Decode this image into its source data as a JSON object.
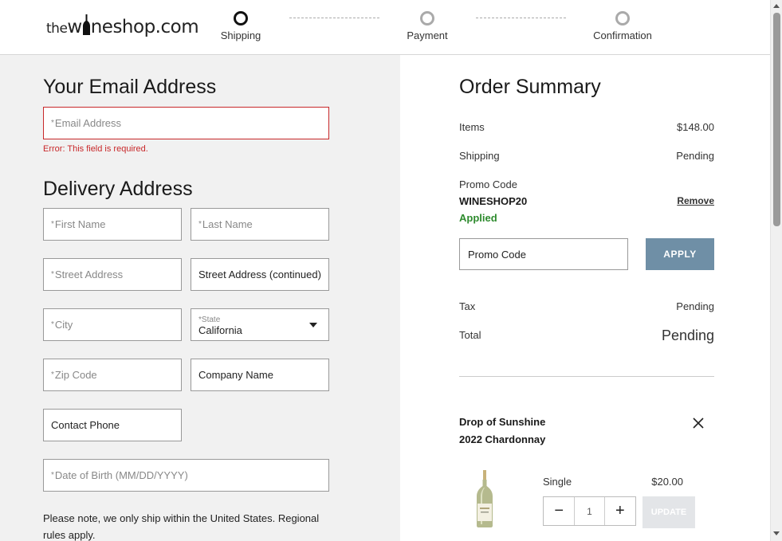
{
  "header": {
    "logo_pre": "the",
    "logo_w": "w",
    "logo_post": "neshop.com",
    "steps": [
      {
        "label": "Shipping",
        "state": "active"
      },
      {
        "label": "Payment",
        "state": "inactive"
      },
      {
        "label": "Confirmation",
        "state": "inactive"
      }
    ]
  },
  "email_section": {
    "title": "Your Email Address",
    "email_placeholder": "Email Address",
    "error": "Error: This field is required."
  },
  "delivery_section": {
    "title": "Delivery Address",
    "first_name": "First Name",
    "last_name": "Last Name",
    "street": "Street Address",
    "street2": "Street Address (continued)",
    "city": "City",
    "state_label": "State",
    "state_value": "California",
    "zip": "Zip Code",
    "company": "Company Name",
    "phone": "Contact Phone",
    "dob": "Date of Birth (MM/DD/YYYY)",
    "note": "Please note, we only ship within the United States. Regional rules apply.",
    "required_mark": "*"
  },
  "order_summary": {
    "title": "Order Summary",
    "items_label": "Items",
    "items_value": "$148.00",
    "shipping_label": "Shipping",
    "shipping_value": "Pending",
    "promo_label": "Promo Code",
    "promo_code": "WINESHOP20",
    "promo_status": "Applied",
    "remove_label": "Remove",
    "promo_input_placeholder": "Promo Code",
    "apply_label": "APPLY",
    "tax_label": "Tax",
    "tax_value": "Pending",
    "total_label": "Total",
    "total_value": "Pending"
  },
  "cart_item": {
    "name_line1": "Drop of Sunshine",
    "name_line2": "2022 Chardonnay",
    "format": "Single",
    "price": "$20.00",
    "quantity": "1",
    "minus": "−",
    "plus": "+",
    "update_label": "UPDATE"
  },
  "colors": {
    "error": "#c8282a",
    "applied": "#2e8b2e",
    "apply_button": "#6f8fa6",
    "left_panel_bg": "#f1f1f1"
  }
}
